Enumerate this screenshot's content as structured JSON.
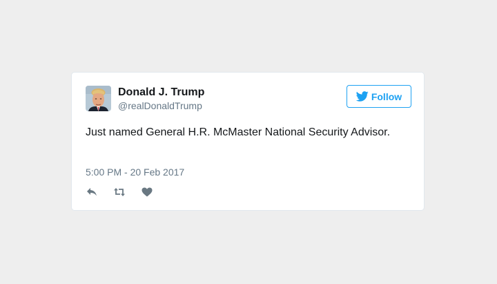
{
  "tweet": {
    "author_name": "Donald J. Trump",
    "author_handle": "@realDonaldTrump",
    "text": "Just named General H.R. McMaster National Security Advisor.",
    "timestamp": "5:00 PM - 20 Feb 2017"
  },
  "follow_button": {
    "label": "Follow",
    "icon": "twitter-bird-icon"
  },
  "actions": {
    "icons": [
      "reply-icon",
      "retweet-icon",
      "like-icon"
    ]
  },
  "colors": {
    "background": "#eeeeee",
    "card": "#ffffff",
    "accent": "#1da1f2",
    "text": "#14171a",
    "muted": "#657786",
    "icon": "#697882"
  }
}
